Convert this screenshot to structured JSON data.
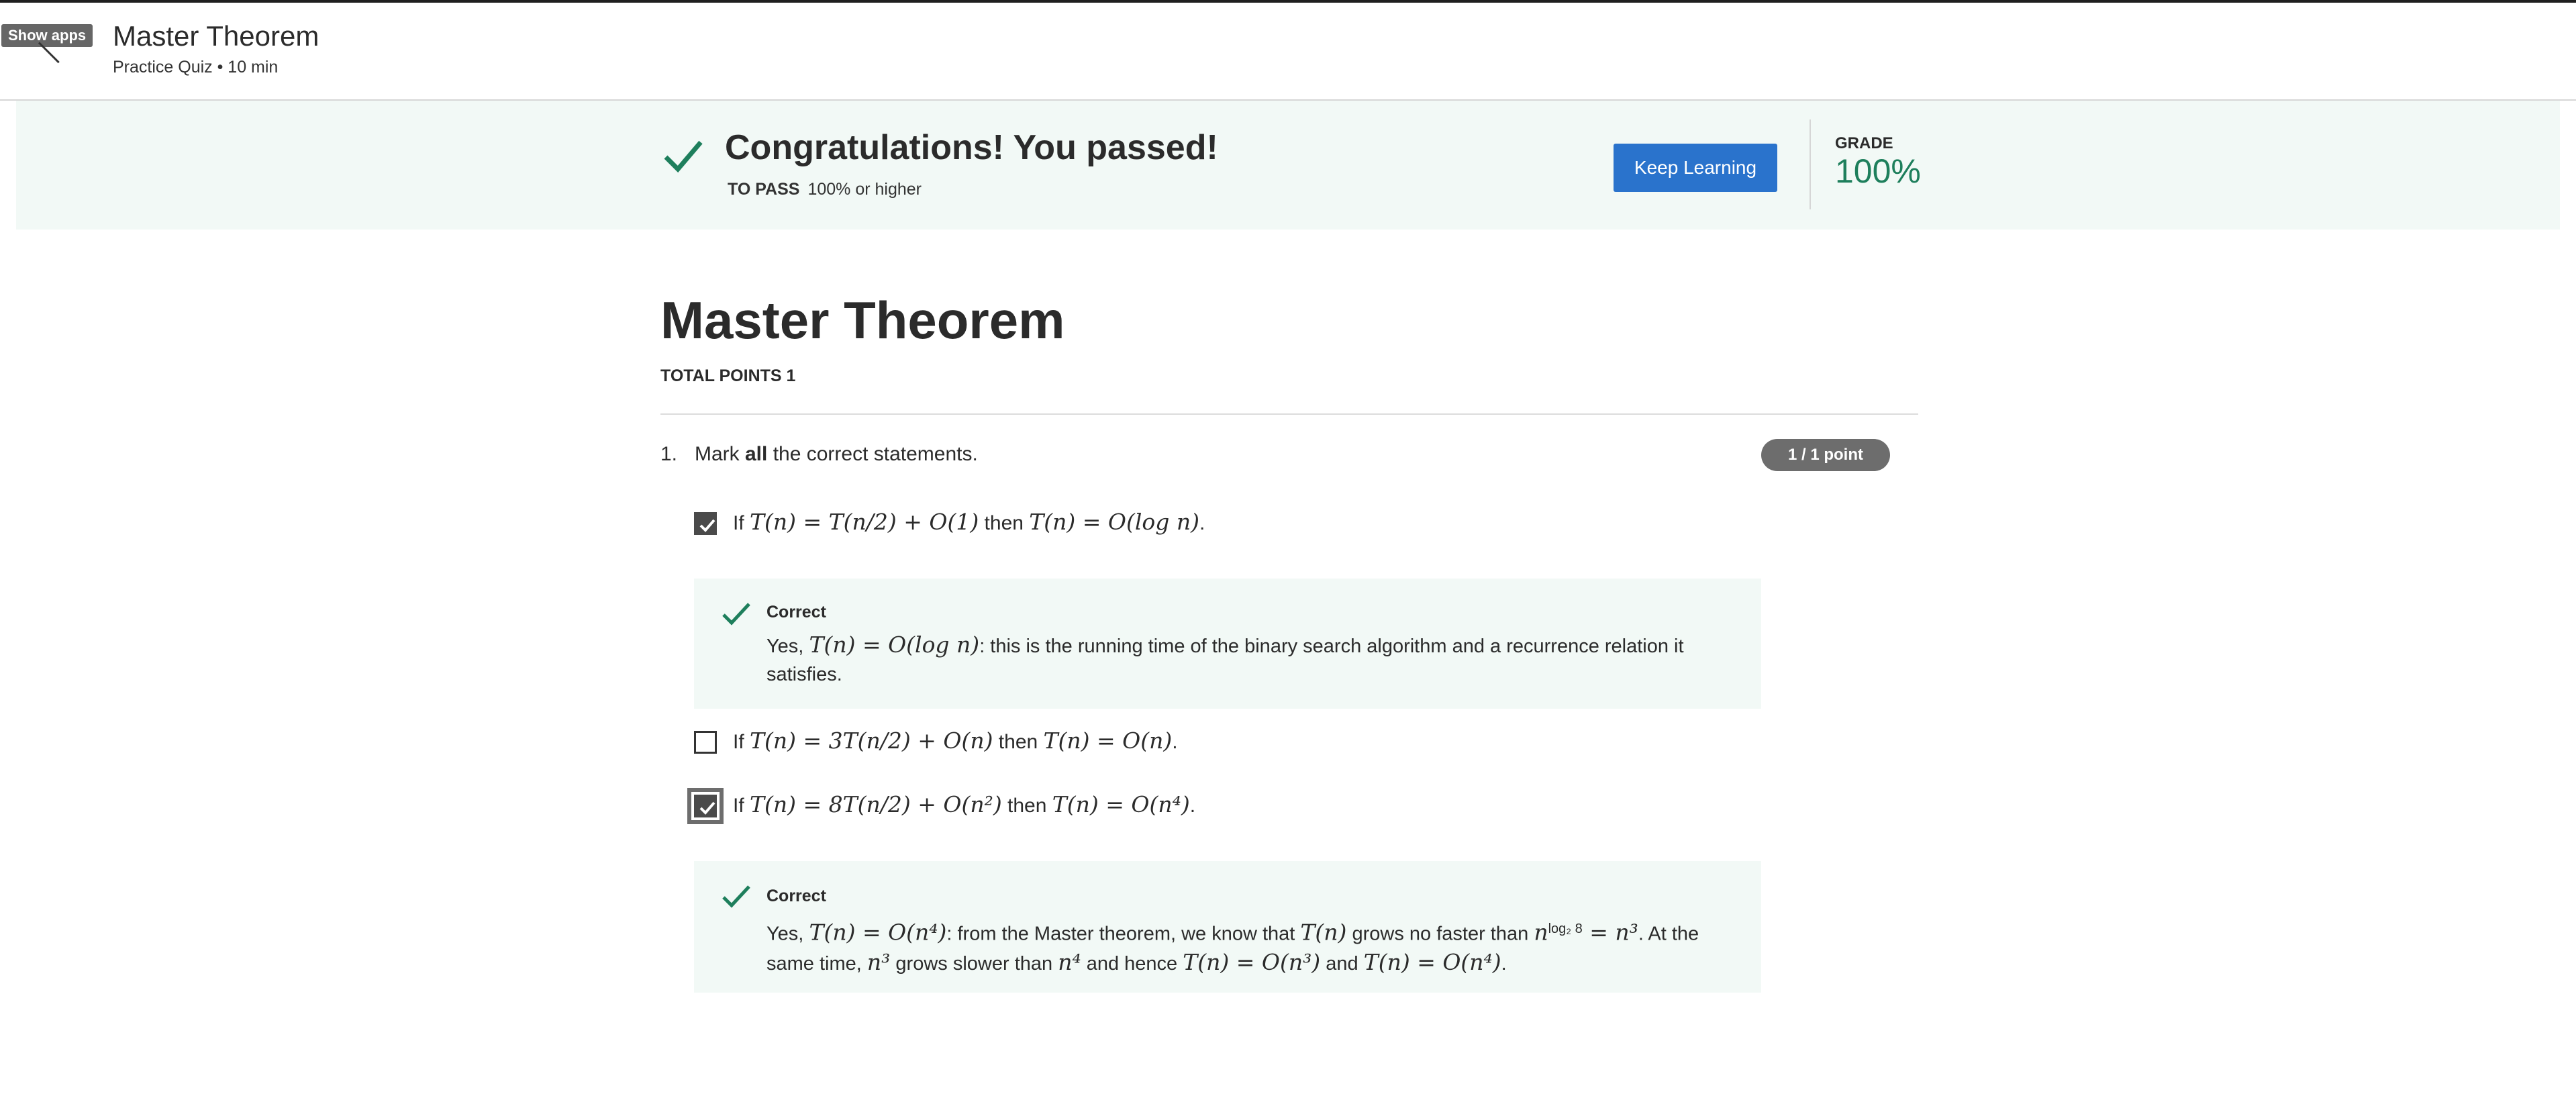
{
  "header": {
    "tooltip": "Show apps",
    "title": "Master Theorem",
    "subtitle": "Practice Quiz • 10 min"
  },
  "banner": {
    "title": "Congratulations! You passed!",
    "to_pass_label": "TO PASS",
    "to_pass_value": "100% or higher",
    "keep_learning": "Keep Learning",
    "grade_label": "GRADE",
    "grade_value": "100%"
  },
  "quiz": {
    "title": "Master Theorem",
    "total_points": "TOTAL POINTS 1",
    "question": {
      "number": "1.",
      "text_pre": "Mark ",
      "text_bold": "all",
      "text_post": " the correct statements.",
      "points": "1 / 1 point"
    },
    "options": [
      {
        "prefix": "If ",
        "math1": "T(n) = T(n/2) + O(1)",
        "mid": " then ",
        "math2": "T(n) = O(log n)",
        "end": ".",
        "checked": true
      },
      {
        "prefix": "If ",
        "math1": "T(n) = 3T(n/2) + O(n)",
        "mid": " then ",
        "math2": "T(n) = O(n)",
        "end": ".",
        "checked": false
      },
      {
        "prefix": "If ",
        "math1": "T(n) = 8T(n/2) + O(n²)",
        "mid": " then ",
        "math2": "T(n) = O(n⁴)",
        "end": ".",
        "checked": true
      }
    ],
    "feedback": [
      {
        "label": "Correct",
        "t1": "Yes, ",
        "m1": "T(n) = O(log n)",
        "t2": ": this is the running time of the binary search algorithm and a recurrence relation it satisfies."
      },
      {
        "label": "Correct",
        "t1": "Yes, ",
        "m1": "T(n) = O(n⁴)",
        "t2": ": from the Master theorem, we know that ",
        "m2": "T(n)",
        "t3": " grows no faster than ",
        "m3": "n",
        "sup": "log₂ 8",
        "m4": " = n³",
        "t4": ". At the same time, ",
        "m5": "n³",
        "t5": " grows slower than ",
        "m6": "n⁴",
        "t6": " and hence ",
        "m7": "T(n) = O(n³)",
        "t7": " and ",
        "m8": "T(n) = O(n⁴)",
        "t8": "."
      }
    ]
  },
  "colors": {
    "banner_bg": "#f2f9f6",
    "success_green": "#1e7f5c",
    "primary_button": "#2a73cc",
    "badge_gray": "#6d6d6d"
  },
  "icons": [
    "check-icon",
    "checkbox-checked-icon",
    "checkbox-empty-icon"
  ]
}
